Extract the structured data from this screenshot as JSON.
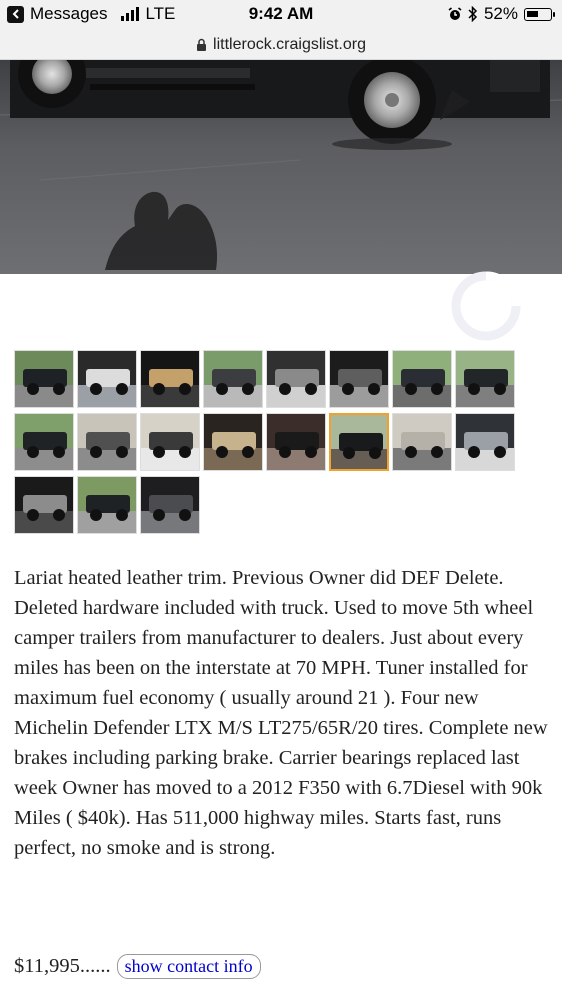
{
  "status_bar": {
    "back_app": "Messages",
    "network": "LTE",
    "time": "9:42 AM",
    "battery_percent": "52%",
    "battery_level": 0.52
  },
  "browser": {
    "url": "littlerock.craigslist.org"
  },
  "gallery": {
    "thumbnail_count": 19,
    "selected_index": 13
  },
  "posting": {
    "description": "Lariat heated leather trim. Previous Owner did DEF Delete. Deleted hardware included with truck. Used to move 5th wheel camper trailers from manufacturer to dealers. Just about every miles has been on the interstate at 70 MPH. Tuner installed for maximum fuel economy ( usually around 21 ). Four new Michelin Defender LTX M/S LT275/65R/20 tires. Complete new brakes including parking brake. Carrier bearings replaced last week Owner has moved to a 2012 F350 with 6.7Diesel with 90k Miles ( $40k). Has 511,000 highway miles. Starts fast, runs perfect, no smoke and is strong.",
    "price_text": "$11,995......",
    "contact_button": "show contact info"
  },
  "colors": {
    "selected_thumb_border": "#f0a22e",
    "link_blue": "#0000cc"
  }
}
